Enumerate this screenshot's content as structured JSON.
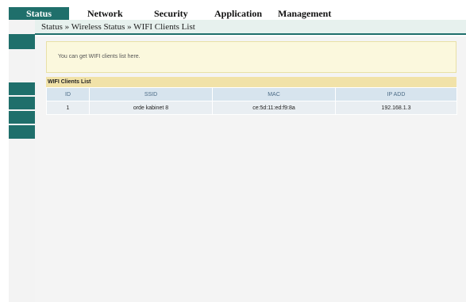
{
  "nav": {
    "tabs": [
      {
        "label": "Status"
      },
      {
        "label": "Network"
      },
      {
        "label": "Security"
      },
      {
        "label": "Application"
      },
      {
        "label": "Management"
      }
    ]
  },
  "breadcrumb": "Status » Wireless Status » WIFI Clients List",
  "info_text": "You can get WIFI clients list here.",
  "table": {
    "title": "WIFI Clients List",
    "headers": [
      "ID",
      "SSID",
      "MAC",
      "IP ADD"
    ],
    "rows": [
      [
        "1",
        "orde kabinet 8",
        "ce:5d:11:ed:f9:8a",
        "192.168.1.3"
      ]
    ]
  },
  "colors": {
    "accent": "#1f6f6b",
    "info_bg": "#fbf8dd",
    "table_title_bg": "#f1e2a8",
    "header_bg": "#d7e4ee"
  }
}
